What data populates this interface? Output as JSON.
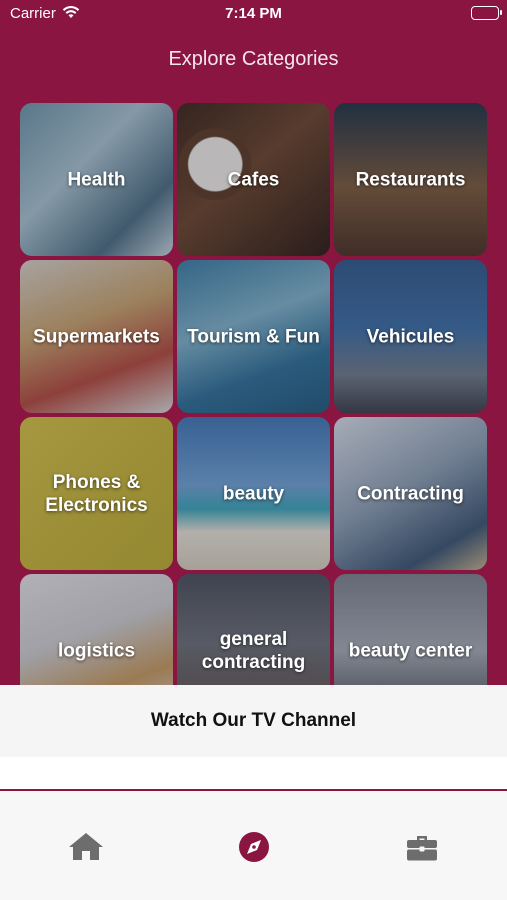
{
  "status_bar": {
    "carrier": "Carrier",
    "time": "7:14 PM"
  },
  "header": {
    "title": "Explore Categories"
  },
  "categories": [
    {
      "label": "Health"
    },
    {
      "label": "Cafes"
    },
    {
      "label": "Restaurants"
    },
    {
      "label": "Supermarkets"
    },
    {
      "label": "Tourism & Fun"
    },
    {
      "label": "Vehicules"
    },
    {
      "label": "Phones & Electronics"
    },
    {
      "label": "beauty"
    },
    {
      "label": "Contracting"
    },
    {
      "label": "logistics"
    },
    {
      "label": "general contracting"
    },
    {
      "label": "beauty  center"
    }
  ],
  "tv_channel": {
    "label": "Watch Our TV Channel"
  },
  "tab_bar": {
    "active_tab": "explore",
    "icons": [
      "home-icon",
      "compass-icon",
      "briefcase-icon"
    ]
  },
  "colors": {
    "brand": "#8a1540",
    "tab_inactive": "#6d6d6d",
    "tab_active": "#8a1540"
  }
}
